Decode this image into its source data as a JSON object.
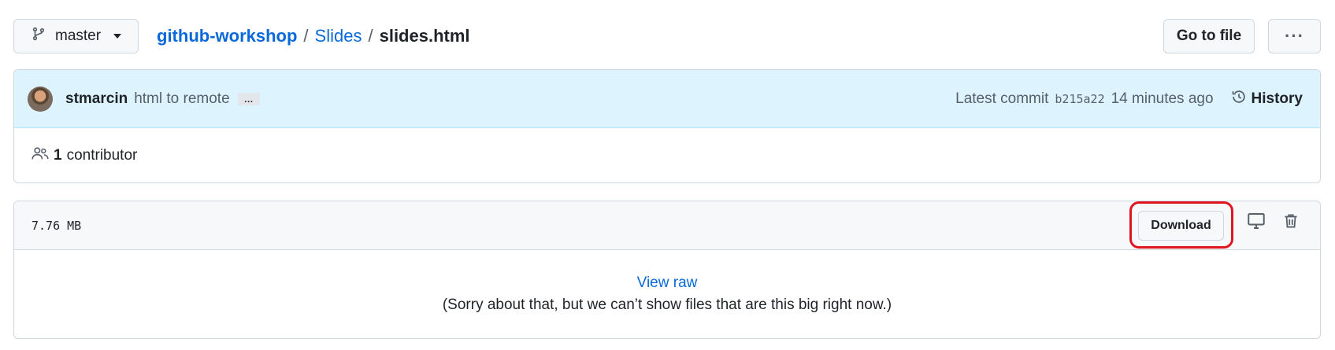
{
  "branch": {
    "name": "master",
    "icon": "git-branch-icon"
  },
  "breadcrumb": {
    "repo": "github-workshop",
    "folder": "Slides",
    "file": "slides.html",
    "separator": "/"
  },
  "toolbar": {
    "goto_label": "Go to file",
    "more_label": "···"
  },
  "commit": {
    "author": "stmarcin",
    "message": "html to remote",
    "ellipsis": "…",
    "latest_label": "Latest commit",
    "sha": "b215a22",
    "time": "14 minutes ago",
    "history_label": "History"
  },
  "contributors": {
    "count": "1",
    "label": "contributor"
  },
  "file": {
    "size": "7.76 MB",
    "download_label": "Download",
    "view_raw": "View raw",
    "notice": "(Sorry about that, but we can’t show files that are this big right now.)"
  },
  "colors": {
    "link": "#0969da",
    "commit_bg": "#ddf4ff",
    "highlight": "#e01522"
  }
}
